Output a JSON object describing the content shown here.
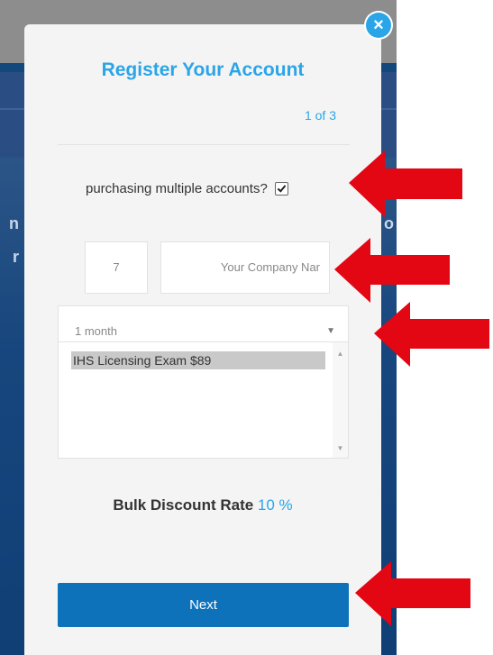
{
  "modal": {
    "title": "Register Your Account",
    "step": "1 of 3",
    "close_label": "×",
    "multi_accounts_label": "purchasing multiple accounts?",
    "multi_accounts_checked": true,
    "quantity_value": "7",
    "company_placeholder": "Your Company Nar",
    "period_selected": "1 month",
    "period_caret": "▼",
    "products": [
      {
        "label": "IHS Licensing Exam $89",
        "selected": true
      }
    ],
    "discount_label": "Bulk Discount Rate",
    "discount_value": "10 %",
    "next_label": "Next"
  },
  "annotation": {
    "arrow_color": "#e30613"
  },
  "colors": {
    "accent": "#2aa5e8",
    "button": "#0e72bb"
  }
}
